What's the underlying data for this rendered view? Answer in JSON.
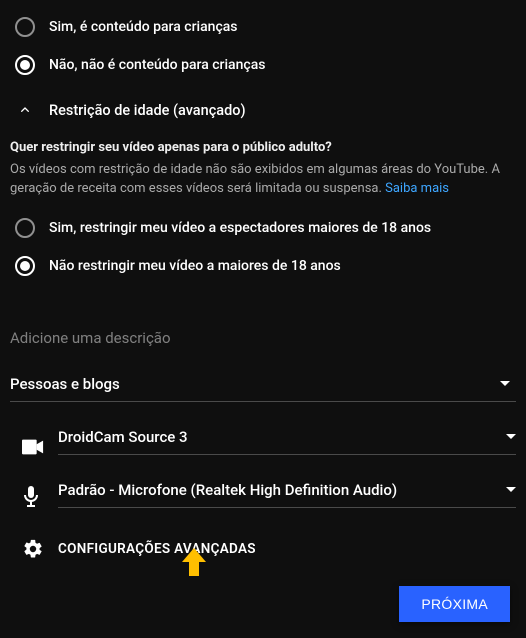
{
  "audience": {
    "yes_label": "Sim, é conteúdo para crianças",
    "no_label": "Não, não é conteúdo para crianças",
    "selected": "no"
  },
  "age_restriction": {
    "section_label": "Restrição de idade (avançado)",
    "question": "Quer restringir seu vídeo apenas para o público adulto?",
    "help_text": "Os vídeos com restrição de idade não são exibidos em algumas áreas do YouTube. A geração de receita com esses vídeos será limitada ou suspensa. ",
    "learn_more": "Saiba mais",
    "yes_label": "Sim, restringir meu vídeo a espectadores maiores de 18 anos",
    "no_label": "Não restringir meu vídeo a maiores de 18 anos",
    "selected": "no"
  },
  "description": {
    "placeholder": "Adicione uma descrição"
  },
  "category": {
    "selected": "Pessoas e blogs"
  },
  "camera": {
    "selected": "DroidCam Source 3"
  },
  "microphone": {
    "selected": "Padrão - Microfone (Realtek High Definition Audio)"
  },
  "advanced_settings": {
    "label": "CONFIGURAÇÕES AVANÇADAS"
  },
  "footer": {
    "next": "PRÓXIMA"
  }
}
